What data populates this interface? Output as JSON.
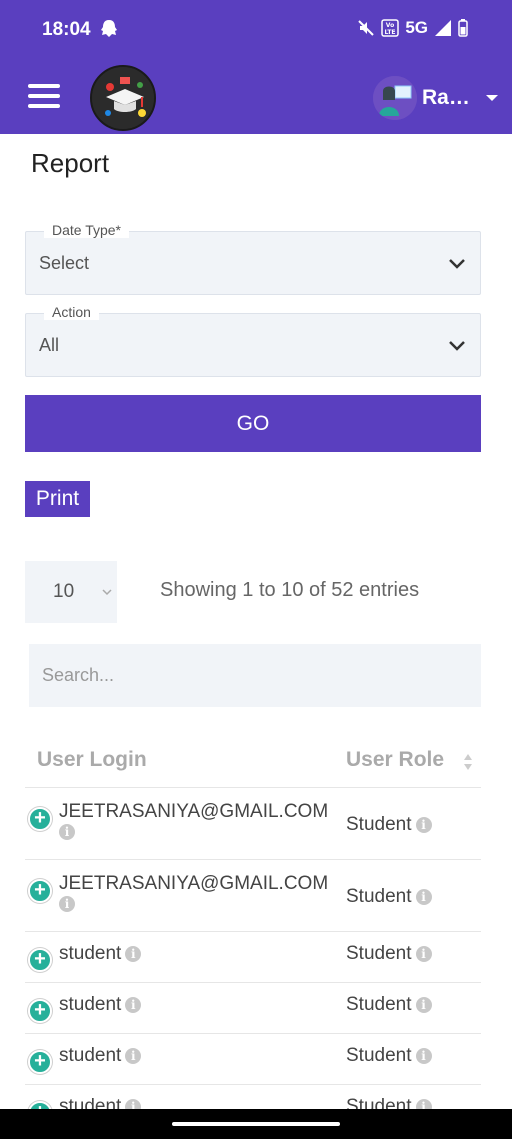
{
  "status_bar": {
    "time": "18:04",
    "network": "5G",
    "volte": "Vo LTE"
  },
  "header": {
    "user_name": "Raq..."
  },
  "page": {
    "title": "Report"
  },
  "filters": {
    "date_type": {
      "label": "Date Type*",
      "value": "Select"
    },
    "action": {
      "label": "Action",
      "value": "All"
    },
    "go_label": "GO",
    "print_label": "Print"
  },
  "table_controls": {
    "page_length": "10",
    "info": "Showing 1 to 10 of 52 entries",
    "search_placeholder": "Search..."
  },
  "table": {
    "columns": [
      "User Login",
      "User Role"
    ],
    "rows": [
      {
        "login": "JEETRASANIYA@GMAIL.COM",
        "role": "Student"
      },
      {
        "login": "JEETRASANIYA@GMAIL.COM",
        "role": "Student"
      },
      {
        "login": "student",
        "role": "Student"
      },
      {
        "login": "student",
        "role": "Student"
      },
      {
        "login": "student",
        "role": "Student"
      },
      {
        "login": "student",
        "role": "Student"
      }
    ]
  },
  "colors": {
    "brand": "#5a3fbf",
    "expand_button": "#26b09a",
    "field_background": "#f1f4f8"
  },
  "icons": [
    "menu-icon",
    "ghost-icon",
    "mute-icon",
    "signal-icon",
    "battery-icon",
    "chevron-down-icon",
    "sort-icon",
    "plus-icon",
    "info-icon"
  ]
}
